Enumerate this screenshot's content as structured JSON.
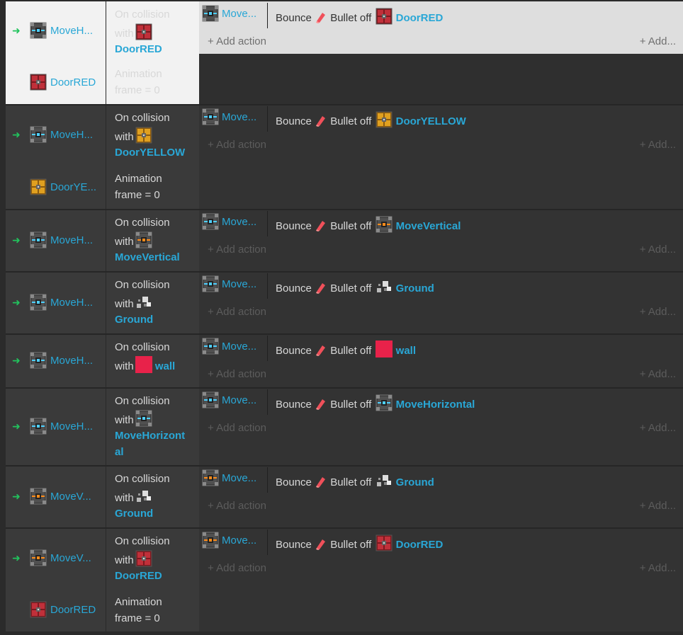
{
  "common": {
    "on_collision": "On collision",
    "with": "with",
    "animation": "Animation",
    "frame_zero": "frame = 0",
    "bounce": "Bounce",
    "bullet_off": "Bullet off",
    "add_action": "Add action",
    "add_more": "Add...",
    "arrow": "➜"
  },
  "events": [
    {
      "obj": "MoveH...",
      "obj_icon": "blue-crate-icon",
      "target": "DoorRED",
      "target_icon": "red-door-icon",
      "act_obj": "Move...",
      "act_icon": "blue-crate-icon",
      "second_obj": "DoorRED",
      "second_icon": "red-door-icon",
      "selected": true
    },
    {
      "obj": "MoveH...",
      "obj_icon": "blue-crate-icon",
      "target": "DoorYELLOW",
      "target_icon": "yellow-door-icon",
      "act_obj": "Move...",
      "act_icon": "blue-crate-icon",
      "second_obj": "DoorYE...",
      "second_icon": "yellow-door-icon"
    },
    {
      "obj": "MoveH...",
      "obj_icon": "blue-crate-icon",
      "target": "MoveVertical",
      "target_icon": "orange-crate-icon",
      "act_obj": "Move...",
      "act_icon": "blue-crate-icon"
    },
    {
      "obj": "MoveH...",
      "obj_icon": "blue-crate-icon",
      "target": "Ground",
      "target_icon": "ground-icon",
      "act_obj": "Move...",
      "act_icon": "blue-crate-icon"
    },
    {
      "obj": "MoveH...",
      "obj_icon": "blue-crate-icon",
      "target": "wall",
      "target_icon": "wall-swatch",
      "act_obj": "Move...",
      "act_icon": "blue-crate-icon"
    },
    {
      "obj": "MoveH...",
      "obj_icon": "blue-crate-icon",
      "target": "MoveHorizontal",
      "target_wrap": [
        "MoveHorizont",
        "al"
      ],
      "target_icon": "blue-crate-icon",
      "act_obj": "Move...",
      "act_icon": "blue-crate-icon"
    },
    {
      "obj": "MoveV...",
      "obj_icon": "orange-crate-icon",
      "target": "Ground",
      "target_icon": "ground-icon",
      "act_obj": "Move...",
      "act_icon": "orange-crate-icon"
    },
    {
      "obj": "MoveV...",
      "obj_icon": "orange-crate-icon",
      "target": "DoorRED",
      "target_icon": "red-door-icon",
      "act_obj": "Move...",
      "act_icon": "orange-crate-icon",
      "second_obj": "DoorRED",
      "second_icon": "red-door-icon"
    }
  ],
  "colors": {
    "accent": "#29a7d6",
    "arrow": "#21c45d",
    "wall": "#e8224a",
    "bg": "#333333"
  }
}
